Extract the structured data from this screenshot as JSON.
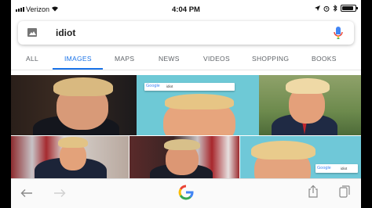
{
  "status_bar": {
    "carrier": "Verizon",
    "time": "4:04 PM",
    "battery_level": 0.85,
    "icons": [
      "signal-icon",
      "wifi-icon",
      "location-icon",
      "alarm-icon",
      "bluetooth-icon",
      "battery-icon"
    ]
  },
  "search": {
    "query": "idiot",
    "left_icon": "image-search-icon",
    "right_icon": "microphone-icon"
  },
  "tabs": [
    {
      "label": "ALL",
      "active": false
    },
    {
      "label": "IMAGES",
      "active": true
    },
    {
      "label": "MAPS",
      "active": false
    },
    {
      "label": "NEWS",
      "active": false
    },
    {
      "label": "VIDEOS",
      "active": false
    },
    {
      "label": "SHOPPING",
      "active": false
    },
    {
      "label": "BOOKS",
      "active": false
    }
  ],
  "results": {
    "thumbnails": [
      {
        "google_logo": "",
        "query": ""
      },
      {
        "google_logo": "Google",
        "query": "idiot"
      },
      {
        "google_logo": "",
        "query": ""
      },
      {
        "google_logo": "",
        "query": ""
      },
      {
        "google_logo": "",
        "query": ""
      },
      {
        "google_logo": "Google",
        "query": "idiot"
      }
    ]
  },
  "toolbar": {
    "icons": [
      "back-arrow-icon",
      "forward-arrow-icon",
      "google-g-logo",
      "share-icon",
      "tabs-icon"
    ],
    "google_letter": "G"
  },
  "colors": {
    "accent_blue": "#1a73e8",
    "google_blue": "#4285f4",
    "google_red": "#ea4335",
    "google_yellow": "#fbbc05",
    "google_green": "#34a853"
  }
}
